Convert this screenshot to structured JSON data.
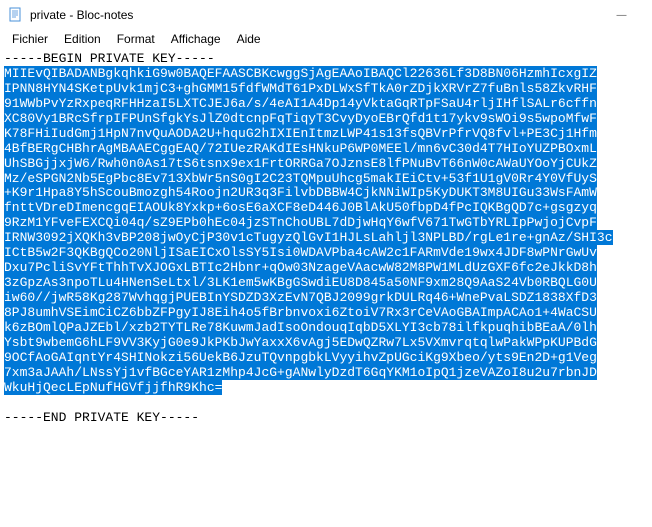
{
  "window": {
    "title": "private - Bloc-notes",
    "controls": {
      "minimize": "—"
    }
  },
  "menu": {
    "file": "Fichier",
    "edit": "Edition",
    "format": "Format",
    "view": "Affichage",
    "help": "Aide"
  },
  "body": {
    "begin_marker": "-----BEGIN PRIVATE KEY-----",
    "end_marker": "-----END PRIVATE KEY-----",
    "lines": [
      "MIIEvQIBADANBgkqhkiG9w0BAQEFAASCBKcwggSjAgEAAoIBAQCl22636Lf3D8BN06HzmhIcxgIZ",
      "IPNN8HYN4SKetpUvk1mjC3+ghGMM15fdfWMdT61PxDLWxSfTkA0rZDjkXRVrZ7fuBnls58ZkvRHF",
      "91WWbPvYzRxpeqRFHHzaI5LXTCJEJ6a/s/4eAI1A4Dp14yVktaGqRTpFSaU4rljIHflSALr6cffn",
      "XC80Vy1BRcSfrpIFPUnSfgkYsJlZ0dtcnpFqTiqyT3CvyDyoEBrQfd1t17ykv9sWOi9s5wpoMfwF",
      "K78FHiIudGmj1HpN7nvQuAODA2U+hquG2hIXIEnItmzLWP41s13fsQBVrPfrVQ8fvl+PE3Cj1Hfm",
      "4BfBERgCHBhrAgMBAAECggEAQ/72IUezRAKdIEsHNkuP6WP0MEEl/mn6vC30d4T7HIoYUZPBOxmL",
      "UhSBGjjxjW6/Rwh0n0As17tS6tsnx9ex1FrtORRGa7OJznsE8lfPNuBvT66nW0cAWaUYOoYjCUkZ",
      "Mz/eSPGN2Nb5EgPbc8Ev713XbWr5nS0gI2C23TQMpuUhcg5makIEiCtv+53f1U1gV0Rr4Y0VfUyS",
      "+K9r1Hpa8Y5hScouBmozgh54Roojn2UR3q3FilvbDBBW4CjkNNiWIp5KyDUKT3M8UIGu33WsFAmW",
      "fnttVDreDImencgqEIAOUk8Yxkp+6osE6aXCF8eD446J0BlAkU50fbpD4fPcIQKBgQD7c+gsgzyq",
      "9RzM1YFveFEXCQi04q/sZ9EPb0hEc04jzSTnChoUBL7dDjwHqY6wfV671TwGTbYRLIpPwjojCvpF",
      "IRNW3092jXQKh3vBP208jwOyCjP30v1cTugyzQlGvI1HJLsLahljl3NPLBD/rgLe1re+gnAz/SHI3c",
      "ICtB5w2F3QKBgQCo20NljISaEICxOlsSY5Isi0WDAVPba4cAW2c1FARmVde19wx4JDF8wPNrGwUv",
      "Dxu7PcliSvYFtThhTvXJOGxLBTIc2Hbnr+qOw03NzageVAacwW82M8PW1MLdUzGXF6fc2eJkkD8h",
      "3zGpzAs3npoTLu4HNenSeLtxl/3LK1em5wKBgGSwdiEU8D845a50NF9xm28Q9AaS24Vb0RBQLG0U",
      "iw60//jwR58Kg287WvhqgjPUEBInYSDZD3XzEvN7QBJ2099grkDULRq46+WnePvaLSDZ1838XfD3",
      "8PJ8umhVSEimCiCZ6bbZFPgyIJ8Eih4o5fBrbnvoxi6ZtoiV7Rx3rCeVAoGBAImpACAo1+4WaCSU",
      "k6zBOmlQPaJZEbl/xzb2TYTLRe78KuwmJadIsoOndouqIqbD5XLYI3cb78ilfkpuqhibBEaA/0lh",
      "Ysbt9wbemG6hLF9VV3KyjG0e9JkPKbJwYaxxX6vAgj5EDwQZRw7Lx5VXmvrqtqlwPakWPpKUPBdG",
      "9OCfAoGAIqntYr4SHINokzi56UekB6JzuTQvnpgbkLVyyihvZpUGciKg9Xbeo/yts9En2D+g1Veg",
      "7xm3aJAAh/LNssYj1vfBGceYAR1zMhp4JcG+gANwlyDzdT6GqYKM1oIpQ1jzeVAZoI8u2u7rbnJD",
      "WkuHjQecLEpNufHGVfjjfhR9Khc="
    ]
  }
}
